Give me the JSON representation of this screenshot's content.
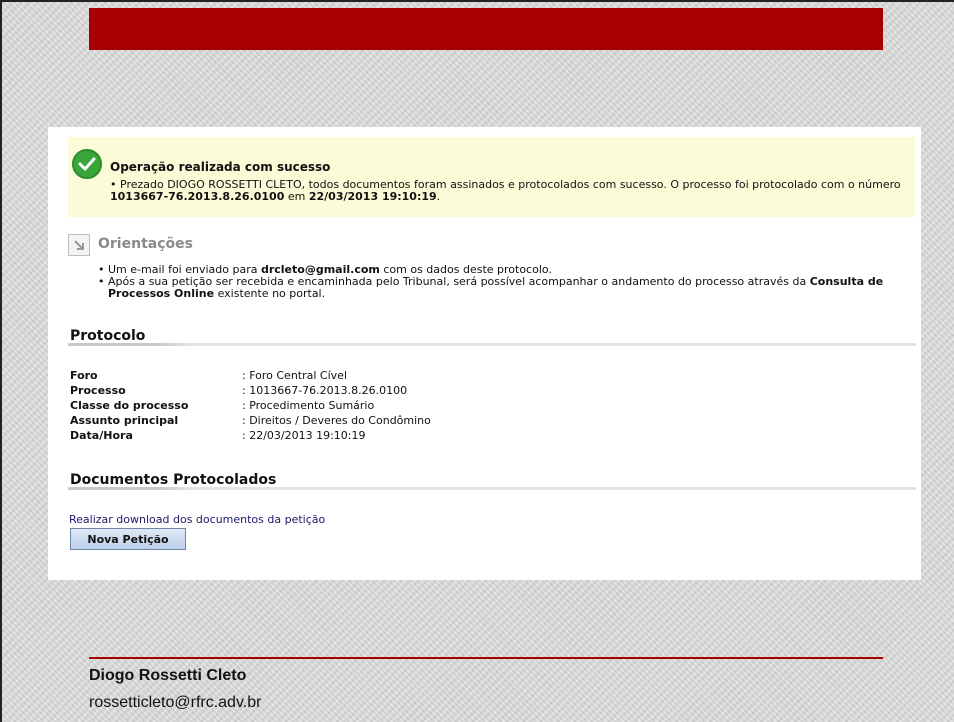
{
  "success": {
    "title": "Operação realizada com sucesso",
    "message_part1": "Prezado DIOGO ROSSETTI CLETO, todos documentos foram assinados e protocolados com sucesso. O processo foi protocolado com o número ",
    "process_number": "1013667-76.2013.8.26.0100",
    "message_part2": " em ",
    "datetime": "22/03/2013 19:10:19",
    "message_part3": "."
  },
  "orientacoes": {
    "title": "Orientações",
    "item1_prefix": "Um e-mail foi enviado para ",
    "item1_email": "drcleto@gmail.com",
    "item1_suffix": " com os dados deste protocolo.",
    "item2_prefix": "Após a sua petição ser recebida e encaminhada pelo Tribunal, será possível acompanhar o andamento do processo através da ",
    "item2_link": "Consulta de Processos Online",
    "item2_suffix": " existente no portal."
  },
  "protocolo": {
    "title": "Protocolo",
    "rows": [
      {
        "label": "Foro",
        "value": ": Foro Central Cível"
      },
      {
        "label": "Processo",
        "value": ": 1013667-76.2013.8.26.0100"
      },
      {
        "label": "Classe do processo",
        "value": ": Procedimento Sumário"
      },
      {
        "label": "Assunto principal",
        "value": ": Direitos / Deveres do Condômino"
      },
      {
        "label": "Data/Hora",
        "value": ": 22/03/2013 19:10:19"
      }
    ]
  },
  "documentos": {
    "title": "Documentos Protocolados",
    "download_link": "Realizar download dos documentos da petição",
    "button_label": "Nova Petição"
  },
  "footer": {
    "name": "Diogo Rossetti Cleto",
    "email": "rossetticleto@rfrc.adv.br"
  },
  "colors": {
    "accent_red": "#a80000",
    "success_bg": "#fbfbd7",
    "success_green": "#3aa63a"
  }
}
